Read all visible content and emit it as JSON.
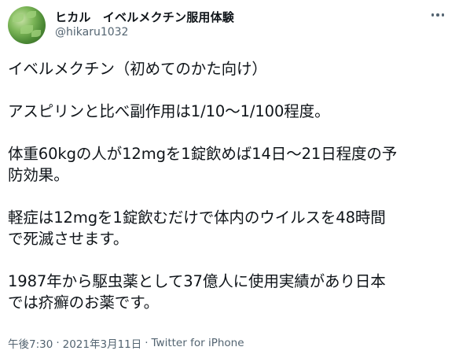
{
  "tweet": {
    "display_name": "ヒカル　イベルメクチン服用体験",
    "handle": "@hikaru1032",
    "lines": [
      "イベルメクチン（初めてのかた向け）",
      "",
      "アスピリンと比べ副作用は1/10〜1/100程度。",
      "",
      "体重60kgの人が12mgを1錠飲めば14日〜21日程度の予",
      "防効果。",
      "",
      "軽症は12mgを1錠飲むだけで体内のウイルスを48時間",
      "で死滅させます。",
      "",
      "1987年から駆虫薬として37億人に使用実績があり日本",
      "では疥癬のお薬です。"
    ],
    "time": "午後7:30",
    "separator1": "·",
    "date": "2021年3月11日",
    "separator2": "·",
    "source": "Twitter for iPhone"
  },
  "icons": {
    "more": "more-horizontal-icon",
    "avatar": "avatar-image"
  },
  "colors": {
    "text_primary": "#0f1419",
    "text_secondary": "#536471",
    "background": "#ffffff"
  }
}
